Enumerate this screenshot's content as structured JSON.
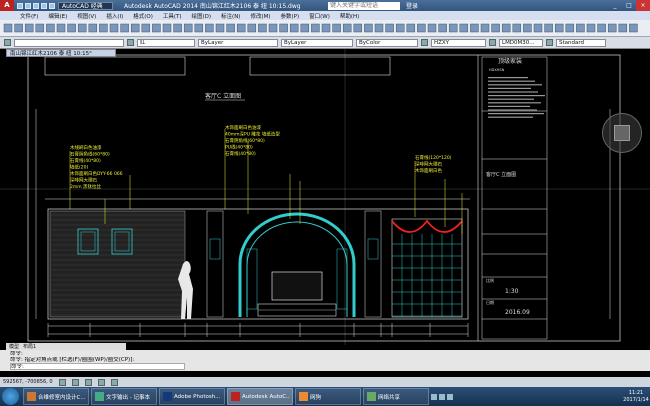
{
  "titlebar": {
    "app_icon": "A",
    "workspace": "AutoCAD 经典",
    "title": "Autodesk AutoCAD 2014   南山锦江红木2106 泰 纽 10:15.dwg",
    "search_placeholder": "键入关键字或短语",
    "login": "登录"
  },
  "menubar": [
    "文件(F)",
    "编辑(E)",
    "视图(V)",
    "插入(I)",
    "格式(O)",
    "工具(T)",
    "绘图(D)",
    "标注(N)",
    "修改(M)",
    "参数(P)",
    "窗口(W)",
    "帮助(H)"
  ],
  "propbar": {
    "layer": "红",
    "linetype1": "ByLayer",
    "linetype2": "ByLayer",
    "color": "ByColor",
    "textstyle": "HZXY",
    "dimstyle": "LMD0M30...",
    "tablestyle": "Standard"
  },
  "filetab": "南山锦江红木2106 泰 纽 10:15°",
  "drawing": {
    "title1": "客厅C 立面图",
    "notes_left": [
      "木线刷白色油漆",
      "石膏阴角线(60*80)",
      "石膏线(40*80)",
      "墙纸(20)",
      "木饰面刷白色DYY-66 066",
      "深啡网大理石",
      "2mm 黑钛拉丝"
    ],
    "notes_center": [
      "木饰面刷白色油漆",
      "40mm深PU 雕花 墙纸造型",
      "石膏阴角线(60*80)",
      "PU线(40*80)",
      "石膏线(40*80)"
    ],
    "notes_right": [
      "石膏线(120*120)",
      "深啡网大理石",
      "木饰面刷白色"
    ],
    "title_block": {
      "company": "顶级家装",
      "logo_letters": "HDXHSN",
      "scale_label": "比例",
      "scale": "1:30",
      "date_label": "日期",
      "date": "2016.09",
      "sheet_name": "客厅C 立面图"
    }
  },
  "layout_tabs": [
    "模型",
    "布局1"
  ],
  "command": {
    "line1": "命令:",
    "line2": "命令: 指定对角点或 [栏选(F)/圈围(WP)/圈交(CP)]:",
    "prompt": "命令:"
  },
  "statusbar": {
    "coords": "592567, -700856, 0"
  },
  "taskbar": {
    "items": [
      {
        "label": "合维修室内设计C...",
        "color": "#c73"
      },
      {
        "label": "文字输出 - 记事本",
        "color": "#4a8"
      },
      {
        "label": "Adobe Photosh...",
        "color": "#123a7a"
      },
      {
        "label": "Autodesk AutoC...",
        "color": "#b22"
      },
      {
        "label": "网狗",
        "color": "#e83"
      },
      {
        "label": "网络共享",
        "color": "#6a6"
      }
    ],
    "time": "11:21",
    "date": "2017/1/14"
  }
}
